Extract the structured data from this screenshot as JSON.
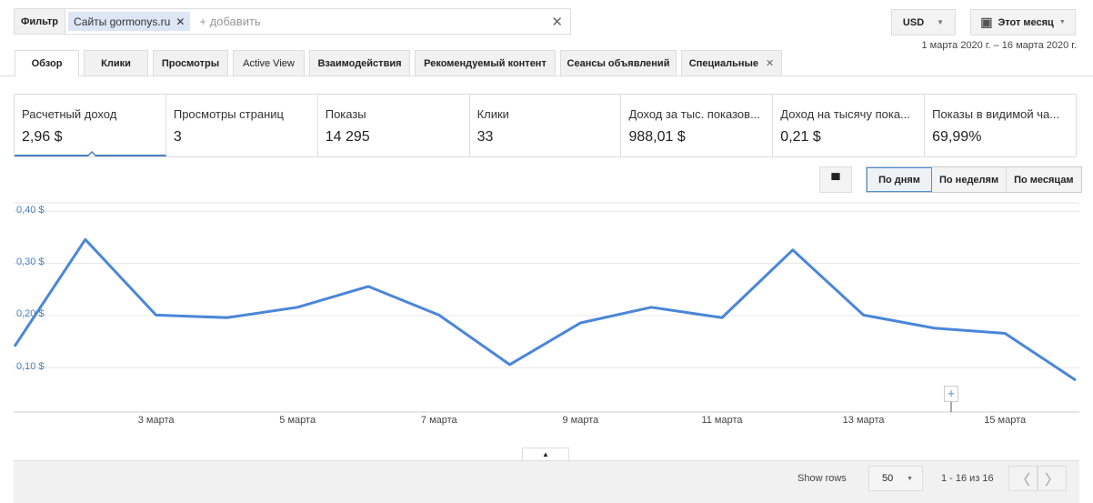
{
  "filter": {
    "button": "Фильтр",
    "chip": "Сайты gormonys.ru",
    "add_placeholder": "+ добавить"
  },
  "currency": "USD",
  "period": "Этот месяц",
  "date_range": "1 марта 2020 г. – 16 марта 2020 г.",
  "tabs": [
    {
      "label": "Обзор",
      "active": true
    },
    {
      "label": "Клики"
    },
    {
      "label": "Просмотры"
    },
    {
      "label": "Active View"
    },
    {
      "label": "Взаимодействия"
    },
    {
      "label": "Рекомендуемый контент"
    },
    {
      "label": "Сеансы объявлений"
    },
    {
      "label": "Специальные",
      "closable": true
    }
  ],
  "metrics": [
    {
      "label": "Расчетный доход",
      "value": "2,96 $"
    },
    {
      "label": "Просмотры страниц",
      "value": "3"
    },
    {
      "label": "Показы",
      "value": "14 295"
    },
    {
      "label": "Клики",
      "value": "33"
    },
    {
      "label": "Доход за тыс. показов...",
      "value": "988,01 $"
    },
    {
      "label": "Доход на тысячу пока...",
      "value": "0,21 $"
    },
    {
      "label": "Показы в видимой ча...",
      "value": "69,99%"
    }
  ],
  "granularity": [
    {
      "label": "По дням",
      "selected": true
    },
    {
      "label": "По неделям"
    },
    {
      "label": "По месяцам"
    }
  ],
  "chart_data": {
    "type": "line",
    "color": "#4a86d9",
    "ylim": [
      0,
      0.4
    ],
    "grid": true,
    "yticks": [
      "0,40 $",
      "0,30 $",
      "0,20 $",
      "0,10 $"
    ],
    "ytick_values": [
      0.4,
      0.3,
      0.2,
      0.1
    ],
    "x": [
      "1 марта",
      "2 марта",
      "3 марта",
      "4 марта",
      "5 марта",
      "6 марта",
      "7 марта",
      "8 марта",
      "9 марта",
      "10 марта",
      "11 марта",
      "12 марта",
      "13 марта",
      "14 марта",
      "15 марта",
      "16 марта"
    ],
    "xticks": [
      "3 марта",
      "5 марта",
      "7 марта",
      "9 марта",
      "11 марта",
      "13 марта",
      "15 марта"
    ],
    "values": [
      0.14,
      0.345,
      0.2,
      0.195,
      0.215,
      0.255,
      0.2,
      0.105,
      0.185,
      0.215,
      0.195,
      0.325,
      0.2,
      0.175,
      0.165,
      0.075
    ]
  },
  "table": {
    "show_rows_label": "Show rows",
    "rows": "50",
    "pagination": "1 - 16 из 16"
  }
}
